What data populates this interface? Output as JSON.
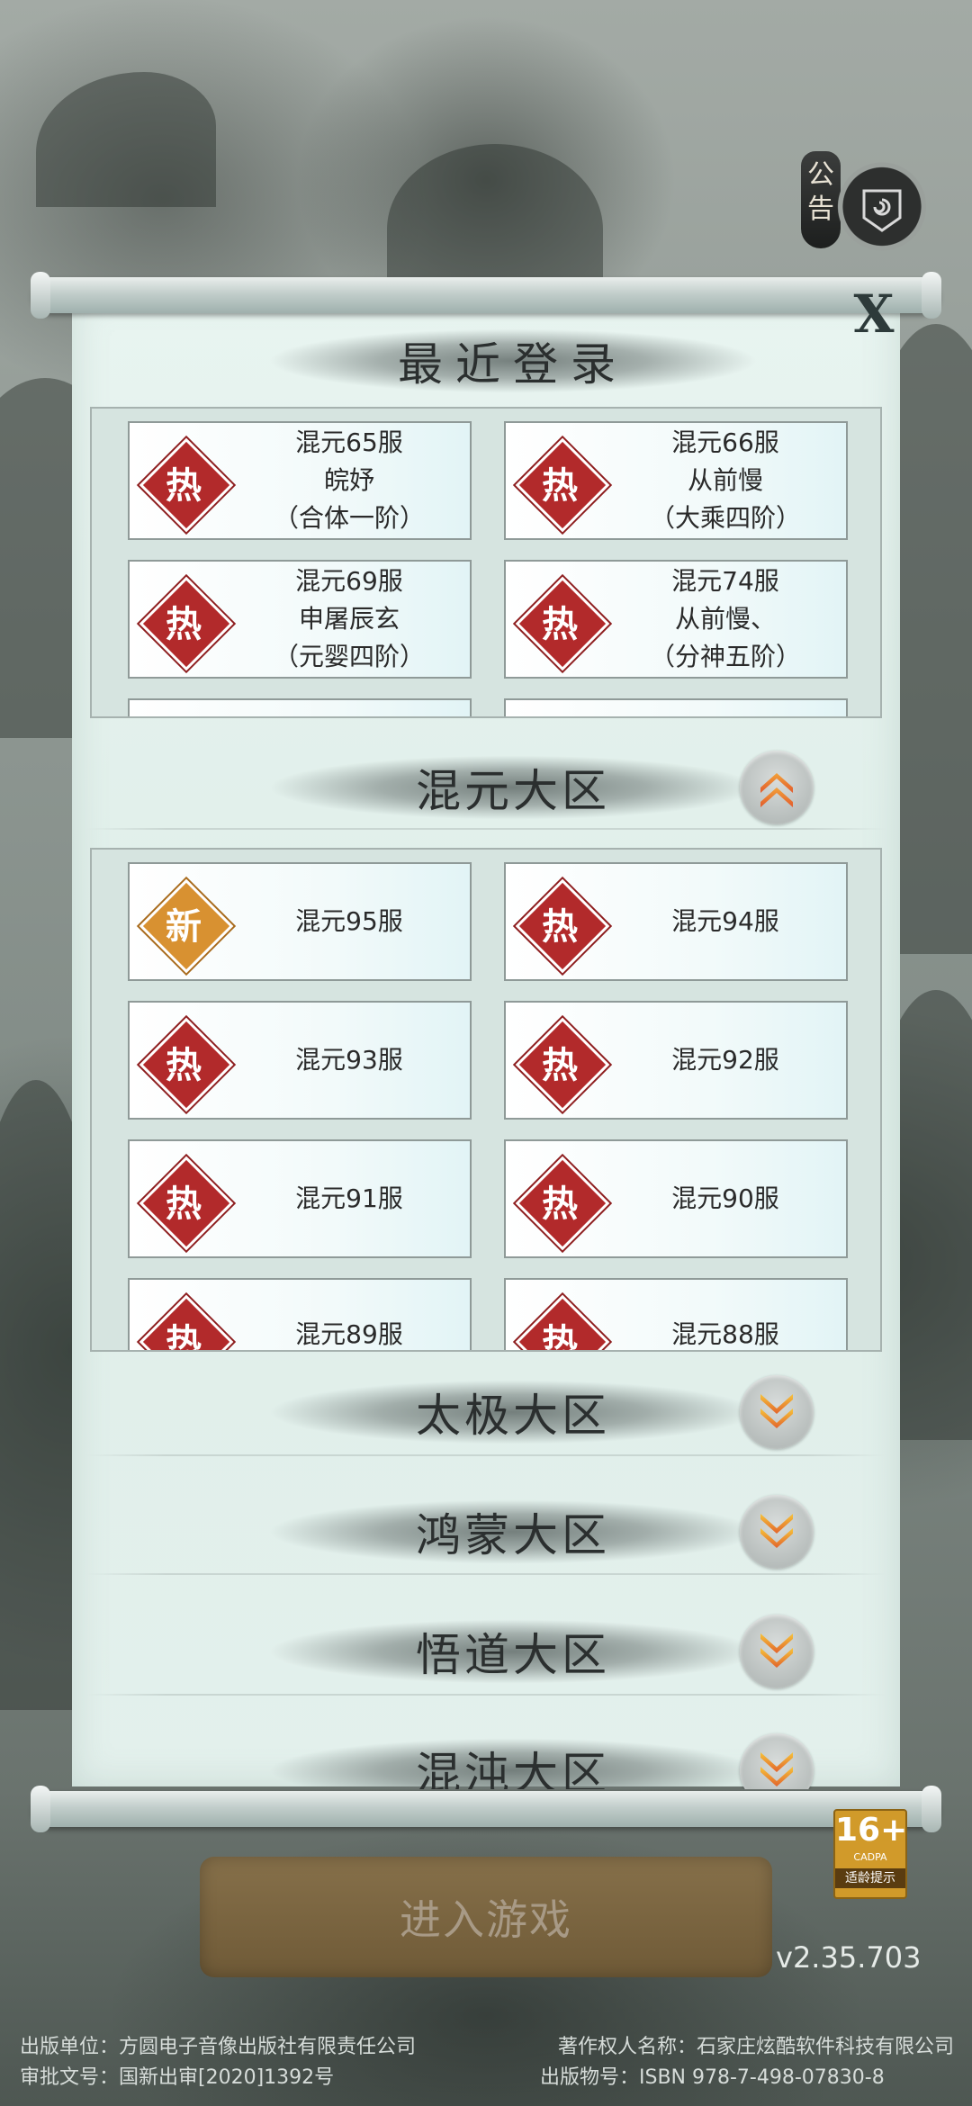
{
  "notice": {
    "label": "公告"
  },
  "close_label": "X",
  "recent": {
    "title": "最近登录",
    "servers": [
      {
        "badge": "热",
        "name": "混元65服",
        "player": "皖妤",
        "rank": "（合体一阶）"
      },
      {
        "badge": "热",
        "name": "混元66服",
        "player": "从前慢",
        "rank": "（大乘四阶）"
      },
      {
        "badge": "热",
        "name": "混元69服",
        "player": "申屠辰玄",
        "rank": "（元婴四阶）"
      },
      {
        "badge": "热",
        "name": "混元74服",
        "player": "从前慢、",
        "rank": "（分神五阶）"
      }
    ]
  },
  "hunyuan": {
    "title": "混元大区",
    "servers": [
      {
        "badge": "新",
        "name": "混元95服"
      },
      {
        "badge": "热",
        "name": "混元94服"
      },
      {
        "badge": "热",
        "name": "混元93服"
      },
      {
        "badge": "热",
        "name": "混元92服"
      },
      {
        "badge": "热",
        "name": "混元91服"
      },
      {
        "badge": "热",
        "name": "混元90服"
      },
      {
        "badge": "热",
        "name": "混元89服"
      },
      {
        "badge": "热",
        "name": "混元88服"
      }
    ]
  },
  "regions": [
    "太极大区",
    "鸿蒙大区",
    "悟道大区",
    "混沌大区"
  ],
  "enter_button": "进入游戏",
  "version": "v2.35.703",
  "age_rating": {
    "num": "16+",
    "org": "CADPA",
    "tip": "适龄提示"
  },
  "footer": {
    "line1_left": "出版单位：方圆电子音像出版社有限责任公司",
    "line1_right": "著作权人名称：石家庄炫酷软件科技有限公司",
    "line2_left": "审批文号：国新出审[2020]1392号",
    "line2_right": "出版物号：ISBN 978-7-498-07830-8"
  },
  "colors": {
    "hot": "#b22a2b",
    "new": "#d89131",
    "enter": "#7a6540"
  }
}
